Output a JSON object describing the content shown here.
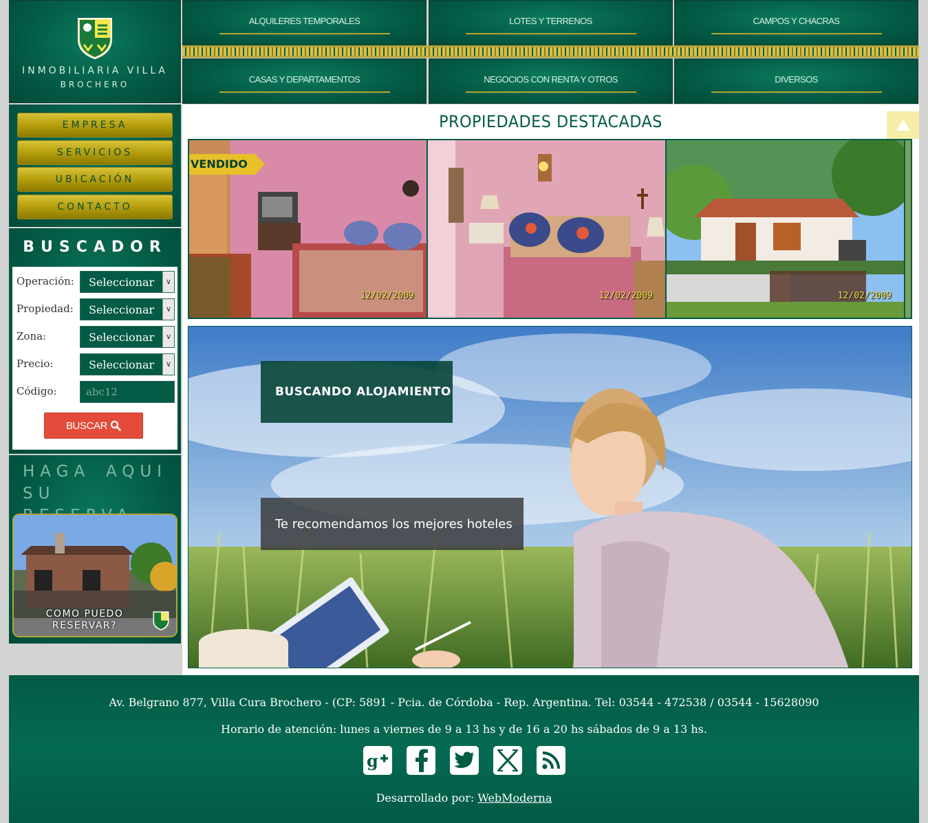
{
  "site": {
    "name_line1": "Inmobiliaria Villa",
    "name_line2": "Brochero"
  },
  "topnav": [
    {
      "label": "Alquileres temporales"
    },
    {
      "label": "Lotes y terrenos"
    },
    {
      "label": "Campos y chacras"
    },
    {
      "label": "Casas y departamentos"
    },
    {
      "label": "Negocios con renta y otros"
    },
    {
      "label": "Diversos"
    }
  ],
  "sidemenu": [
    {
      "label": "Empresa"
    },
    {
      "label": "Servicios"
    },
    {
      "label": "Ubicación"
    },
    {
      "label": "Contacto"
    }
  ],
  "buscador": {
    "title": "BUSCADOR",
    "fields": [
      {
        "label": "Operación:",
        "value": "Seleccionar"
      },
      {
        "label": "Propiedad:",
        "value": "Seleccionar"
      },
      {
        "label": "Zona:",
        "value": "Seleccionar"
      },
      {
        "label": "Precio:",
        "value": "Seleccionar"
      }
    ],
    "codigo_label": "Código:",
    "codigo_placeholder": "abc12",
    "button": "BUSCAR"
  },
  "reserva": {
    "title_line1": "HAGA AQUI SU",
    "title_line2": "RESERVA",
    "caption_line1": "COMO PUEDO",
    "caption_line2": "RESERVAR?"
  },
  "main": {
    "title": "PROPIEDADES DESTACADAS",
    "badge": "VENDIDO",
    "photos": [
      {
        "date": "12/02/2009",
        "icon": "living-room-photo"
      },
      {
        "date": "12/02/2009",
        "icon": "bedroom-photo"
      },
      {
        "date": "12/02/2009",
        "icon": "house-photo"
      }
    ],
    "scroll_top_icon": "triangle-up-icon"
  },
  "banner": {
    "heading": "BUSCANDO ALOJAMIENTO",
    "subheading": "Te recomendamos los mejores hoteles"
  },
  "footer": {
    "address": "Av. Belgrano 877, Villa Cura Brochero - (CP: 5891 - Pcia. de Córdoba - Rep. Argentina. Tel: 03544 - 472538 / 03544 - 15628090",
    "hours": "Horario de atención: lunes a viernes de 9 a 13 hs y de 16 a 20 hs sábados de 9 a 13 hs.",
    "social": [
      "google-plus-icon",
      "facebook-icon",
      "twitter-icon",
      "xing-icon",
      "rss-icon"
    ],
    "dev_label": "Desarrollado por:",
    "dev_link": "WebModerna"
  },
  "colors": {
    "brand_green": "#035a45",
    "gold": "#b8a637",
    "button_red": "#e44b3a"
  }
}
